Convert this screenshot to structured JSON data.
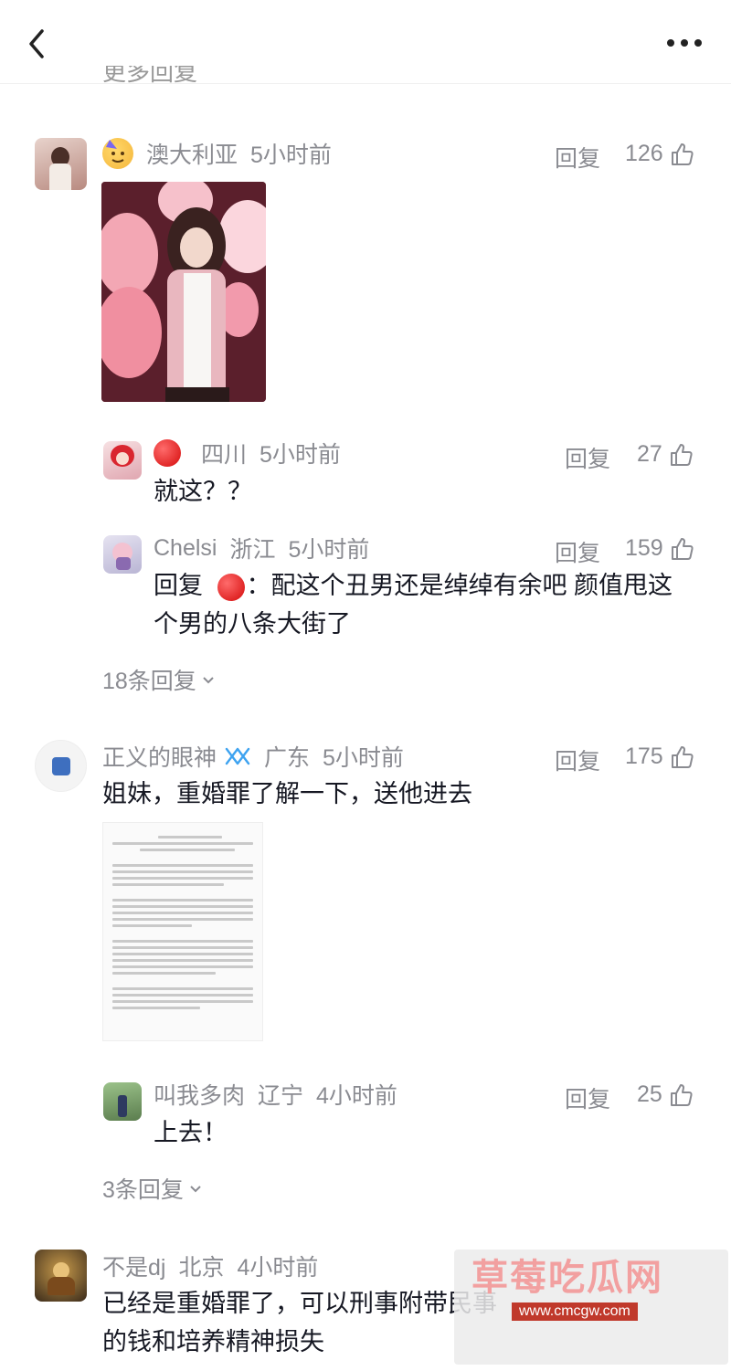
{
  "topbar": {
    "back_icon": "chevron-left-icon",
    "more_icon": "more-dots-icon",
    "partial_text": "更多回复"
  },
  "comments": [
    {
      "user": "澳大利亚",
      "time": "5小时前",
      "reply": "回复",
      "likes": "126"
    },
    {
      "user": "四川",
      "time": "5小时前",
      "reply": "回复",
      "likes": "27",
      "text": "就这？？"
    },
    {
      "user": "Chelsi",
      "location": "浙江",
      "time": "5小时前",
      "reply": "回复",
      "likes": "159",
      "prefix": "回复",
      "text_line1": "：配这个丑男还是绰绰有余吧 颜值甩这",
      "text_line2": "个男的八条大街了"
    },
    {
      "user": "正义的眼神",
      "location": "广东",
      "time": "5小时前",
      "reply": "回复",
      "likes": "175",
      "text": "姐妹，重婚罪了解一下，送他进去"
    },
    {
      "user": "叫我多肉",
      "location": "辽宁",
      "time": "4小时前",
      "reply": "回复",
      "likes": "25",
      "text": "上去！"
    },
    {
      "user": "不是dj",
      "location": "北京",
      "time": "4小时前",
      "text_line1": "已经是重婚罪了，可以刑事附带民事",
      "text_line2": "的钱和培养精神损失"
    }
  ],
  "more_replies": {
    "first": "18条回复",
    "second": "3条回复"
  },
  "watermark": {
    "text": "草莓吃瓜网",
    "url": "www.cmcgw.com"
  },
  "colors": {
    "meta_gray": "#8a8b91",
    "text_dark": "#161823",
    "verified_blue": "#3ea3f0"
  }
}
